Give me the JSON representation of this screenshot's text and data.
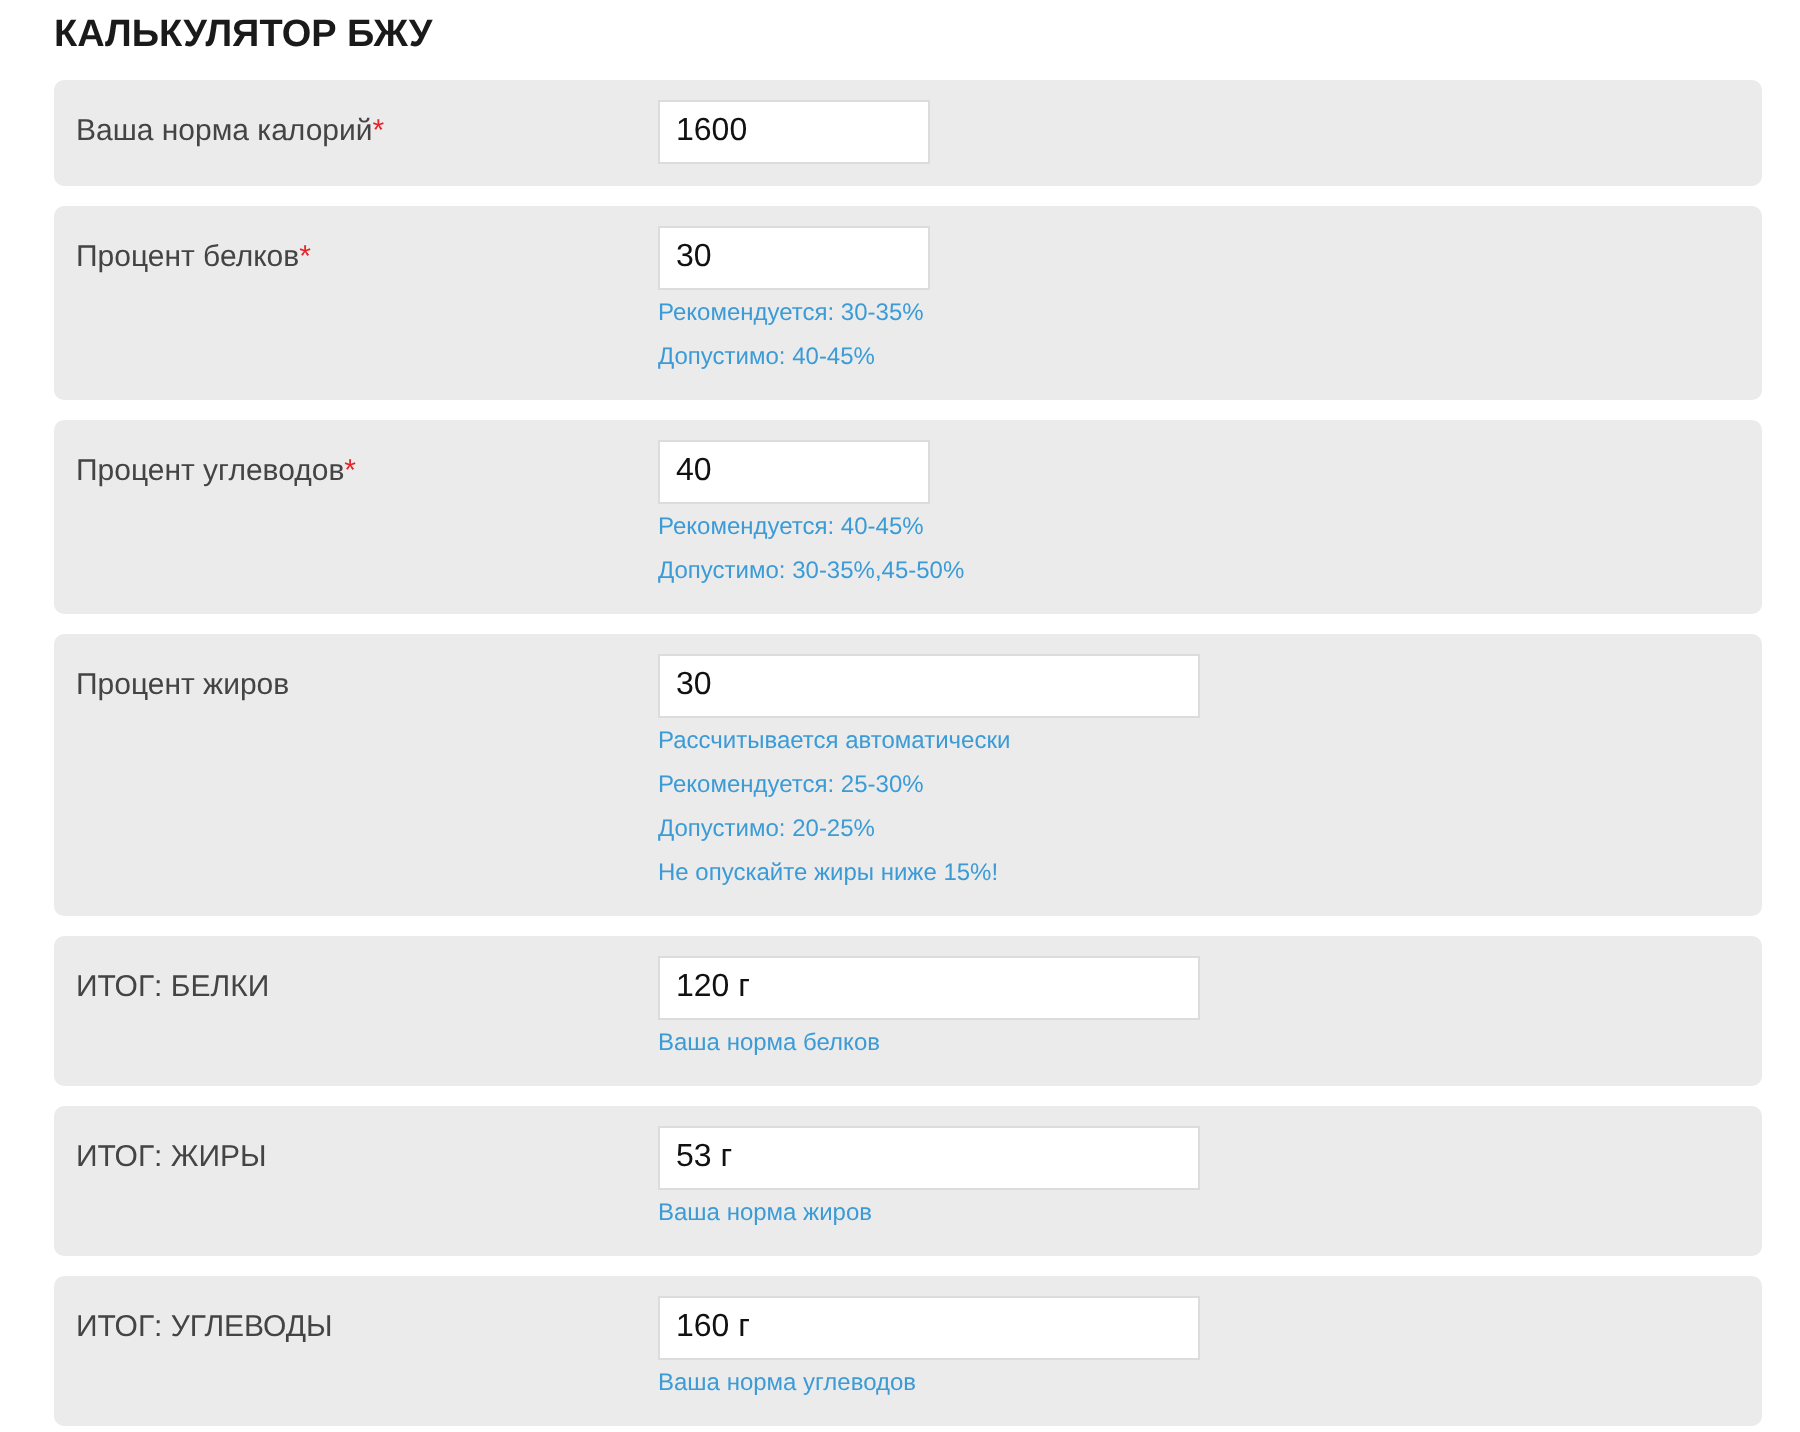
{
  "title": "КАЛЬКУЛЯТОР БЖУ",
  "rows": [
    {
      "kind": "short",
      "label": "Ваша норма калорий",
      "required_mark": "*",
      "value": "1600",
      "hints": []
    },
    {
      "kind": "short",
      "label": "Процент белков",
      "required_mark": "*",
      "value": "30",
      "hints": [
        "Рекомендуется: 30-35%",
        "Допустимо: 40-45%"
      ]
    },
    {
      "kind": "short",
      "label": "Процент углеводов",
      "required_mark": "*",
      "value": "40",
      "hints": [
        "Рекомендуется: 40-45%",
        "Допустимо: 30-35%,45-50%"
      ]
    },
    {
      "kind": "wide",
      "label": "Процент жиров",
      "value": "30",
      "hints": [
        "Рассчитывается автоматически",
        "Рекомендуется: 25-30%",
        "Допустимо: 20-25%",
        "Не опускайте жиры ниже 15%!"
      ]
    },
    {
      "kind": "wide",
      "label": "ИТОГ: БЕЛКИ",
      "value": "120 г",
      "hints": [
        "Ваша норма белков"
      ]
    },
    {
      "kind": "wide",
      "label": "ИТОГ: ЖИРЫ",
      "value": "53 г",
      "hints": [
        "Ваша норма жиров"
      ]
    },
    {
      "kind": "wide",
      "label": "ИТОГ: УГЛЕВОДЫ",
      "value": "160 г",
      "hints": [
        "Ваша норма углеводов"
      ]
    }
  ]
}
